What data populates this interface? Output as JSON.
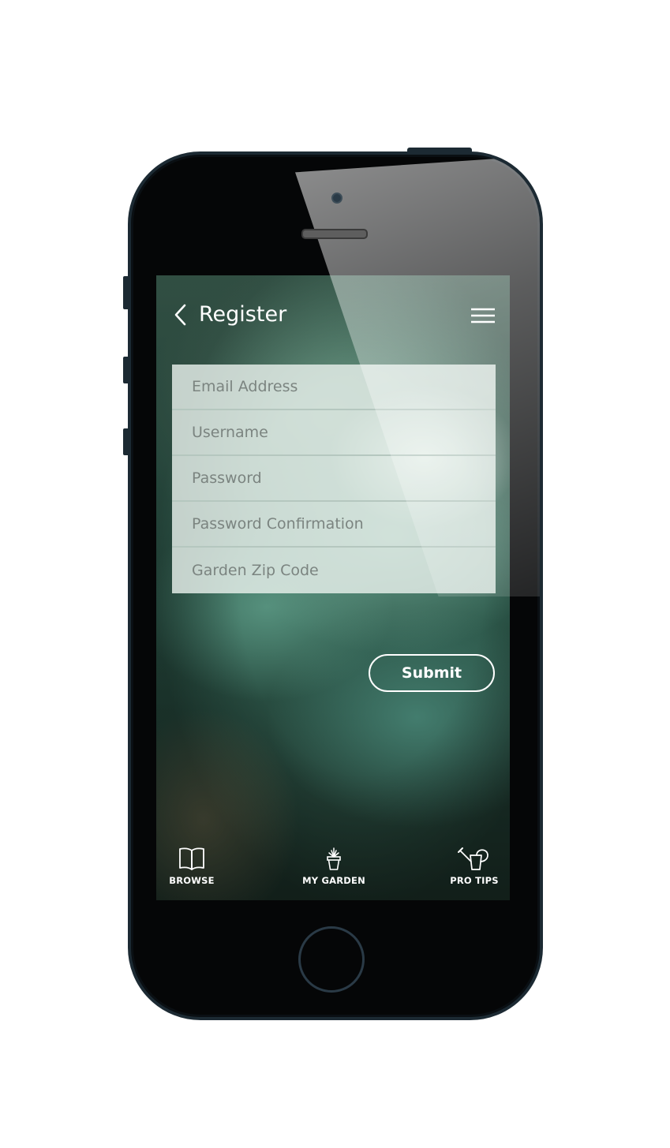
{
  "header": {
    "title": "Register"
  },
  "form": {
    "fields": [
      {
        "placeholder": "Email Address",
        "value": ""
      },
      {
        "placeholder": "Username",
        "value": ""
      },
      {
        "placeholder": "Password",
        "value": ""
      },
      {
        "placeholder": "Password Confirmation",
        "value": ""
      },
      {
        "placeholder": "Garden Zip Code",
        "value": ""
      }
    ],
    "submit_label": "Submit"
  },
  "tabbar": {
    "items": [
      {
        "label": "BROWSE",
        "icon": "book-icon"
      },
      {
        "label": "MY GARDEN",
        "icon": "potted-plant-icon"
      },
      {
        "label": "PRO TIPS",
        "icon": "watering-can-icon"
      }
    ]
  },
  "colors": {
    "phone_body": "#050607",
    "phone_border": "#1c2a33",
    "form_overlay": "#e8f0ec",
    "text_light": "#ffffff"
  }
}
